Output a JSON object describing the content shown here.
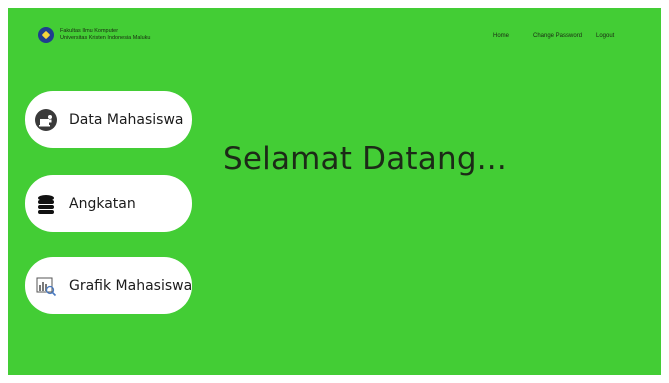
{
  "header": {
    "brand_line1": "Fakultas Ilmu Komputer",
    "brand_line2": "Universitas Kristen Indonesia Maluku",
    "nav": [
      {
        "label": "Home"
      },
      {
        "label": "Change Password"
      },
      {
        "label": "Logout"
      }
    ]
  },
  "menu": [
    {
      "label": "Data Mahasiswa",
      "icon": "laptop-person-icon"
    },
    {
      "label": "Angkatan",
      "icon": "database-icon"
    },
    {
      "label": "Grafik Mahasiswa",
      "icon": "chart-search-icon"
    }
  ],
  "main": {
    "welcome": "Selamat Datang..."
  },
  "colors": {
    "background": "#43cd35",
    "button": "#ffffff",
    "text": "#1c2a17"
  }
}
